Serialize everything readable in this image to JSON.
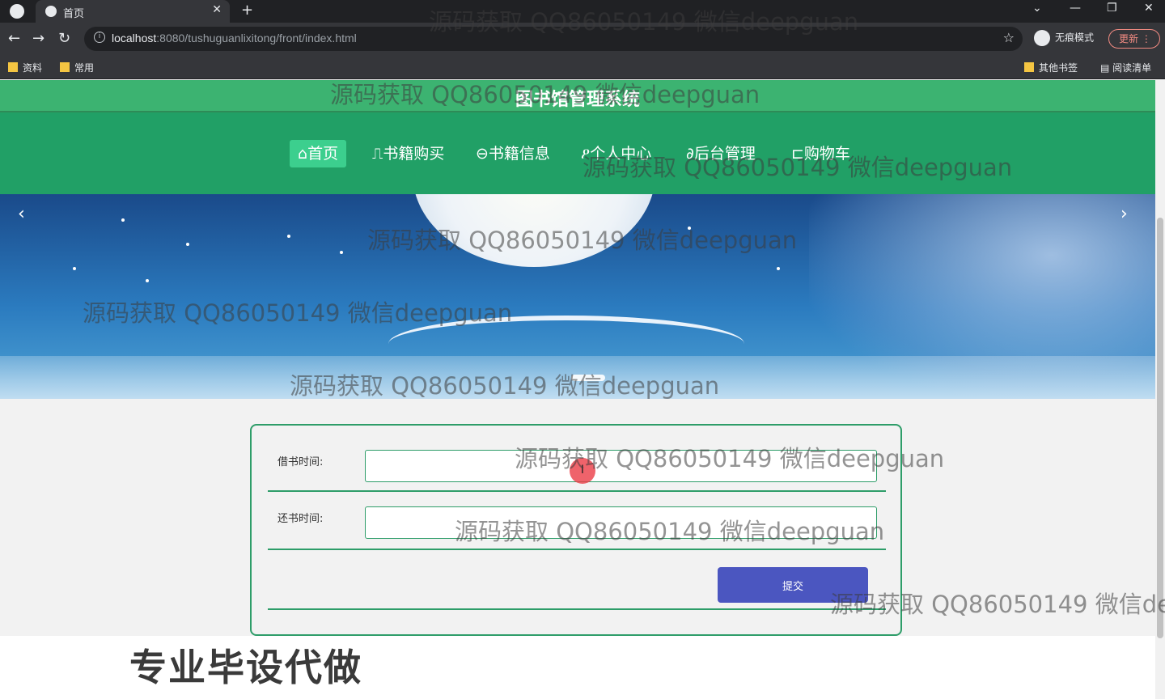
{
  "browser": {
    "tab_title": "首页",
    "url_host": "localhost",
    "url_rest": ":8080/tushuguanlixitong/front/index.html",
    "incognito_label": "无痕模式",
    "update_label": "更新",
    "bookmarks_left": [
      "资料",
      "常用"
    ],
    "bookmarks_right": [
      "其他书签",
      "阅读清单"
    ]
  },
  "site": {
    "title": "图书馆管理系统",
    "nav": [
      {
        "label": "首页",
        "icon": "home-icon",
        "glyph": "⌂"
      },
      {
        "label": "书籍购买",
        "icon": "book-icon",
        "glyph": "⎍"
      },
      {
        "label": "书籍信息",
        "icon": "info-icon",
        "glyph": "⊖"
      },
      {
        "label": "个人中心",
        "icon": "user-icon",
        "glyph": "ዖ"
      },
      {
        "label": "后台管理",
        "icon": "link-icon",
        "glyph": "∂"
      },
      {
        "label": "购物车",
        "icon": "cart-icon",
        "glyph": "⊏"
      }
    ]
  },
  "form": {
    "borrow_label": "借书时间:",
    "borrow_value": "",
    "return_label": "还书时间:",
    "return_value": "",
    "submit_label": "提交"
  },
  "promo_text": "专业毕设代做",
  "watermark": "源码获取 QQ86050149 微信deepguan",
  "colors": {
    "nav_green": "#21a066",
    "top_green": "#3cb371",
    "active_nav": "#3ccf8e",
    "submit_blue": "#4b56c0",
    "border_green": "#2e9d69"
  }
}
